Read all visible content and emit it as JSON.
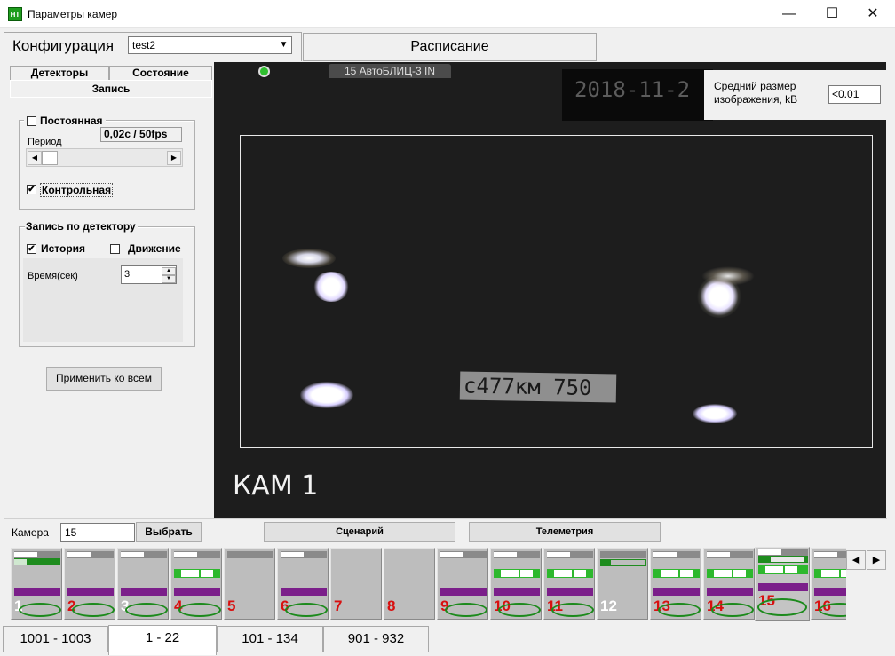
{
  "window": {
    "title": "Параметры камер",
    "app_icon": "НТ",
    "minimize_icon": "—",
    "maximize_icon": "☐",
    "close_icon": "✕"
  },
  "tabs": {
    "config_label": "Конфигурация",
    "config_value": "test2",
    "dropdown_icon": "▼",
    "schedule_label": "Расписание"
  },
  "left_panel": {
    "subtabs": [
      "Детекторы",
      "Состояние",
      "Запись"
    ],
    "permanent": {
      "label": "Постоянная",
      "checked": false,
      "period_label": "Период",
      "period_value": "0,02с / 50fps"
    },
    "scroll_left": "◀",
    "scroll_right": "▶",
    "control": {
      "label": "Контрольная",
      "checked": true
    },
    "detector_group": {
      "title": "Запись по детектору",
      "history": {
        "label": "История",
        "checked": true
      },
      "motion": {
        "label": "Движение",
        "checked": false
      },
      "time_label": "Время(сек)",
      "time_value": "3",
      "spin_up": "▲",
      "spin_down": "▼"
    },
    "apply_all": "Применить ко всем",
    "check_mark": "✔"
  },
  "video": {
    "camera_tab": "15 АвтоБЛИЦ-3 IN",
    "osd_date": "2018-11-2",
    "size_label_line1": "Средний размер",
    "size_label_line2": "изображения, kB",
    "size_value": "<0.01",
    "plate_text": "с477км 750",
    "camera_label": "КАМ 1"
  },
  "controls": {
    "camera_label": "Камера",
    "camera_value": "15",
    "select_button": "Выбрать",
    "scenario_button": "Сценарий",
    "telemetry_button": "Телеметрия"
  },
  "strip": {
    "tiles": [
      "1",
      "2",
      "3",
      "4",
      "5",
      "6",
      "7",
      "8",
      "9",
      "10",
      "11",
      "12",
      "13",
      "14",
      "15",
      "16"
    ],
    "selected": "15",
    "nav_left": "◀",
    "nav_right": "▶"
  },
  "bottom_tabs": {
    "items": [
      "1001 - 1003",
      "1 - 22",
      "101 - 134",
      "901 - 932"
    ],
    "active": "1 - 22"
  },
  "colors": {
    "status_green": "#2db82d",
    "archive_purple": "#7b1f8a",
    "camera_number_red": "#d81010",
    "video_background": "#1d1d1d"
  }
}
